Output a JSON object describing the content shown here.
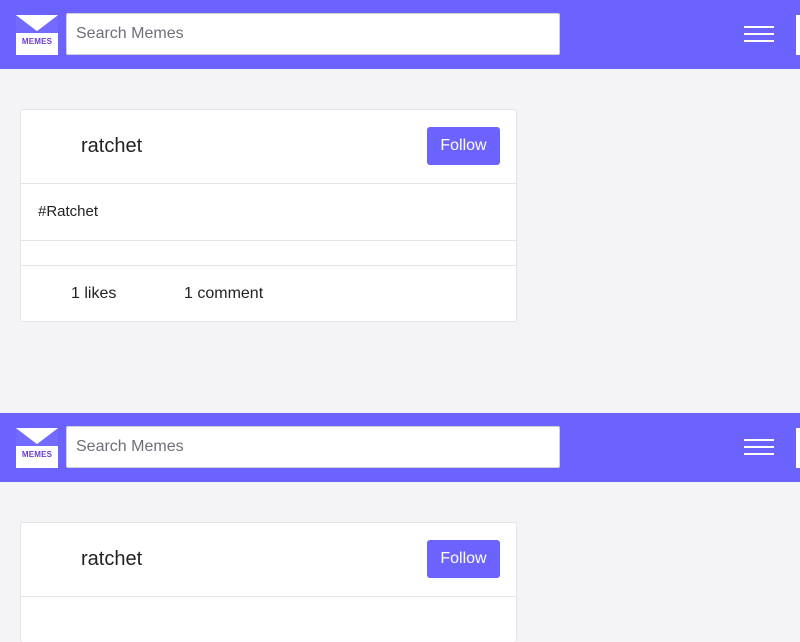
{
  "brand": {
    "logo_text": "MEMES",
    "primary_color": "#6c63ff",
    "logo_text_color": "#6c3ad6"
  },
  "search": {
    "placeholder": "Search Memes",
    "value": ""
  },
  "nav": {
    "menu_icon": "hamburger-menu-icon"
  },
  "post": {
    "username": "ratchet",
    "follow_label": "Follow",
    "hashtag": "#Ratchet",
    "likes": "1 likes",
    "comments": "1 comment"
  }
}
